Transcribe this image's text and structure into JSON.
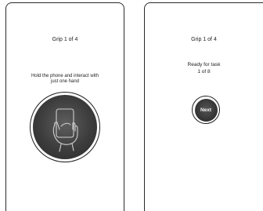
{
  "left_screen": {
    "grip_title": "Grip 1 of 4",
    "instruction_line1": "Hold the phone and interact with",
    "instruction_line2": "just one hand",
    "illustration_icon": "hand-holding-phone-icon"
  },
  "right_screen": {
    "grip_title": "Grip 1 of 4",
    "task_line1": "Ready for task",
    "task_line2": "1 of 8",
    "next_label": "Next"
  },
  "colors": {
    "frame": "#2a2a2a",
    "disc_dark": "#3c3c3c",
    "text": "#222222",
    "button_text": "#f4f4f4"
  }
}
